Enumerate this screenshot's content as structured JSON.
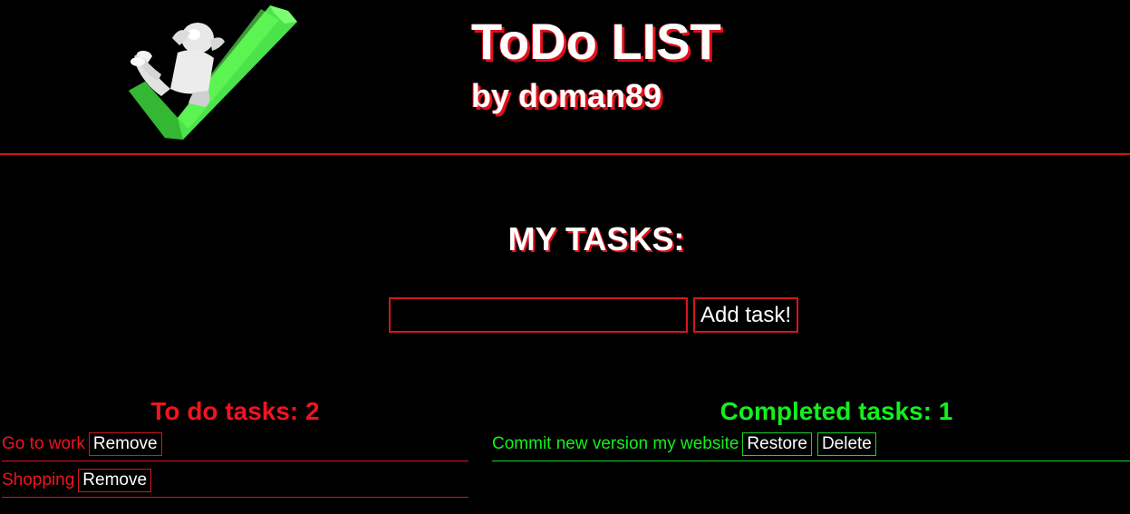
{
  "header": {
    "title": "ToDo LIST",
    "subtitle": "by doman89",
    "logo_icon": "person-relaxing-on-checkmark-icon"
  },
  "main": {
    "heading": "MY TASKS:",
    "input": {
      "value": "",
      "placeholder": ""
    },
    "add_button_label": "Add task!"
  },
  "todo": {
    "heading": "To do tasks: 2",
    "items": [
      {
        "text": "Go to work",
        "remove_label": "Remove"
      },
      {
        "text": "Shopping",
        "remove_label": "Remove"
      }
    ]
  },
  "completed": {
    "heading": "Completed tasks: 1",
    "items": [
      {
        "text": "Commit new version my website",
        "restore_label": "Restore",
        "delete_label": "Delete"
      }
    ]
  },
  "colors": {
    "accent_red": "#d8161d",
    "accent_green": "#14f01e",
    "background": "#000000",
    "text": "#ffffff"
  }
}
